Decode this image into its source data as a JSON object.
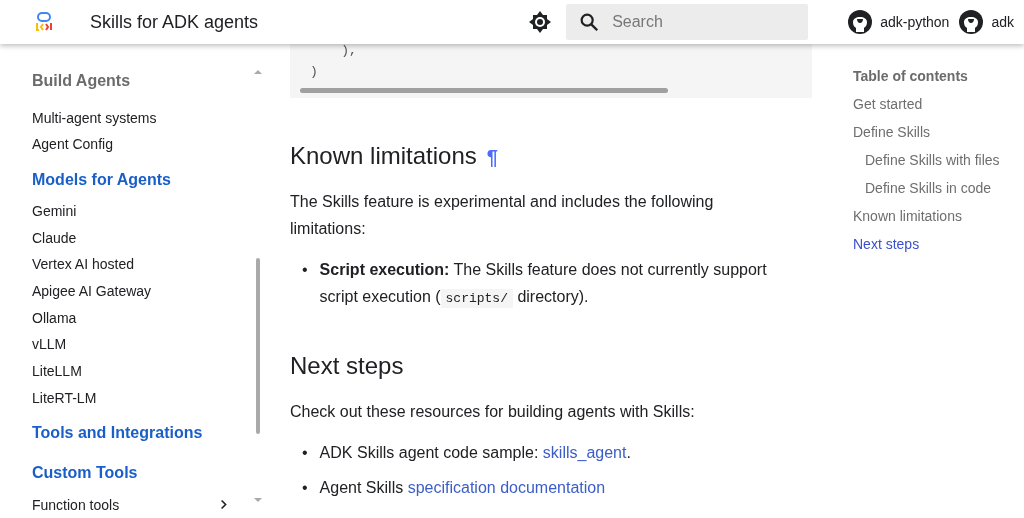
{
  "header": {
    "title": "Skills for ADK agents",
    "search": {
      "placeholder": "Search"
    },
    "repos": [
      {
        "label": "adk-python"
      },
      {
        "label": "adk"
      }
    ]
  },
  "sidebar": {
    "items": [
      {
        "label": "Build Agents",
        "kind": "sticky",
        "expandable": false
      },
      {
        "label": "Multi-agent systems",
        "kind": "link",
        "expandable": false
      },
      {
        "label": "Agent Config",
        "kind": "link",
        "expandable": false
      },
      {
        "label": "Models for Agents",
        "kind": "section",
        "expandable": false
      },
      {
        "label": "Gemini",
        "kind": "link",
        "expandable": false
      },
      {
        "label": "Claude",
        "kind": "link",
        "expandable": false
      },
      {
        "label": "Vertex AI hosted",
        "kind": "link",
        "expandable": false
      },
      {
        "label": "Apigee AI Gateway",
        "kind": "link",
        "expandable": false
      },
      {
        "label": "Ollama",
        "kind": "link",
        "expandable": false
      },
      {
        "label": "vLLM",
        "kind": "link",
        "expandable": false
      },
      {
        "label": "LiteLLM",
        "kind": "link",
        "expandable": false
      },
      {
        "label": "LiteRT-LM",
        "kind": "link",
        "expandable": false
      },
      {
        "label": "Tools and Integrations",
        "kind": "section",
        "expandable": false
      },
      {
        "label": "Custom Tools",
        "kind": "section",
        "expandable": false
      },
      {
        "label": "Function tools",
        "kind": "link",
        "expandable": true
      }
    ]
  },
  "content": {
    "code_lines": [
      "    ),",
      ")"
    ],
    "blocks": [
      {
        "kind": "heading",
        "text": "Known limitations",
        "anchor": "¶"
      },
      {
        "kind": "paragraph",
        "text": "The Skills feature is experimental and includes the following limitations:"
      },
      {
        "kind": "list",
        "items": [
          {
            "marker": "•",
            "parts": [
              {
                "kind": "bold",
                "text": "Script execution:"
              },
              {
                "kind": "text",
                "text": " The Skills feature does not currently support script execution ("
              },
              {
                "kind": "code",
                "text": "scripts/"
              },
              {
                "kind": "text",
                "text": " directory)."
              }
            ]
          }
        ]
      },
      {
        "kind": "heading",
        "text": "Next steps"
      },
      {
        "kind": "paragraph",
        "text": "Check out these resources for building agents with Skills:"
      },
      {
        "kind": "list",
        "items": [
          {
            "marker": "•",
            "parts": [
              {
                "kind": "text",
                "text": "ADK Skills agent code sample: "
              },
              {
                "kind": "link",
                "text": "skills_agent"
              },
              {
                "kind": "text",
                "text": "."
              }
            ]
          },
          {
            "marker": "•",
            "parts": [
              {
                "kind": "text",
                "text": "Agent Skills "
              },
              {
                "kind": "link",
                "text": "specification documentation"
              }
            ]
          }
        ]
      }
    ]
  },
  "toc": {
    "title": "Table of contents",
    "items": [
      {
        "label": "Get started",
        "selected": false
      },
      {
        "label": "Define Skills",
        "selected": false,
        "children": [
          {
            "label": "Define Skills with files",
            "selected": false
          },
          {
            "label": "Define Skills in code",
            "selected": false
          }
        ]
      },
      {
        "label": "Known limitations",
        "selected": false
      },
      {
        "label": "Next steps",
        "selected": true
      }
    ]
  }
}
